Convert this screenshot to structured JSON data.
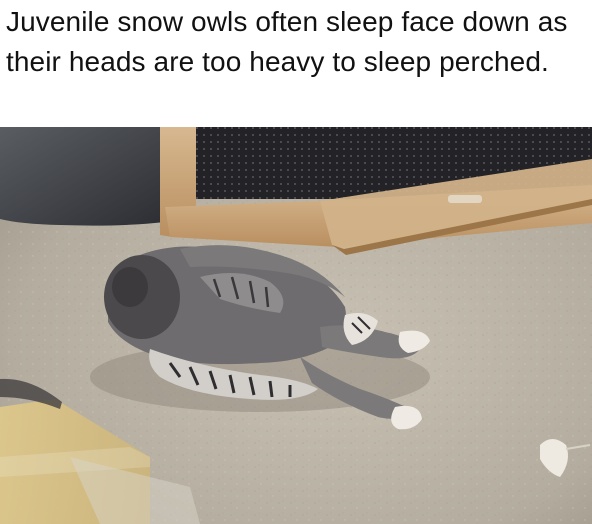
{
  "caption": {
    "text": "Juvenile snow owls often sleep face down as their heads are too heavy to sleep perched."
  },
  "photo": {
    "subject_icon": "owl-chick-sleeping-image",
    "colors": {
      "sand": "#bdb6aa",
      "wood": "#c8a47a",
      "mesh": "#1e1e22",
      "owl_gray": "#6e6c6e",
      "shadow": "#3c3a3c",
      "light_patch": "#d9c58a"
    }
  }
}
